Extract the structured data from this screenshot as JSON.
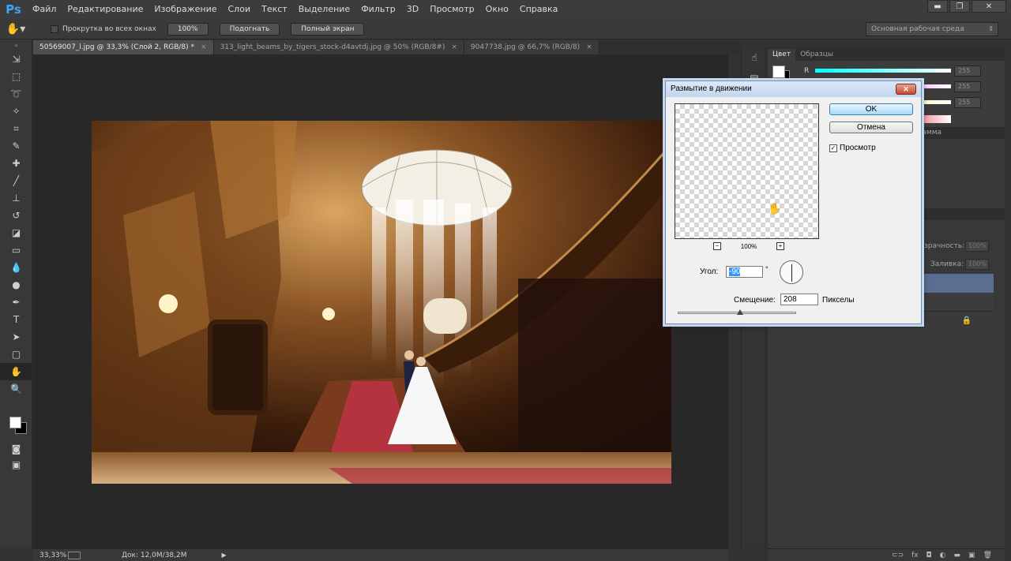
{
  "app": {
    "logo": "Ps"
  },
  "menu": [
    "Файл",
    "Редактирование",
    "Изображение",
    "Слои",
    "Текст",
    "Выделение",
    "Фильтр",
    "3D",
    "Просмотр",
    "Окно",
    "Справка"
  ],
  "window_controls": {
    "minimize": "▬",
    "restore": "❐",
    "close": "✕"
  },
  "options_bar": {
    "scroll_all_label": "Прокрутка во всех окнах",
    "zoom_100": "100%",
    "fit_label": "Подогнать",
    "fullscreen_label": "Полный экран",
    "workspace": "Основная рабочая среда"
  },
  "tabs": [
    {
      "label": "50569007_l.jpg @ 33,3% (Слой 2, RGB/8) *",
      "close": "×",
      "active": true
    },
    {
      "label": "313_light_beams_by_tigers_stock-d4avtdj.jpg @ 50% (RGB/8#)",
      "close": "×",
      "active": false
    },
    {
      "label": "9047738.jpg @ 66,7% (RGB/8)",
      "close": "×",
      "active": false
    }
  ],
  "status": {
    "zoom": "33,33%",
    "doc": "Док: 12,0M/38,2M"
  },
  "panels": {
    "color_tab": "Цвет",
    "swatches_tab": "Образцы",
    "channel_r": "R",
    "values": [
      "255",
      "255",
      "255"
    ],
    "adjust_label": "рамма",
    "opacity_label": "зрачность:",
    "opacity_value": "100%",
    "fill_label": "Заливка:",
    "fill_value": "100%"
  },
  "dialog": {
    "title": "Размытие в движении",
    "close": "✕",
    "ok": "OK",
    "cancel": "Отмена",
    "preview_label": "Просмотр",
    "preview_checked": true,
    "zoom_value": "100%",
    "angle_label": "Угол:",
    "angle_value": "-90",
    "deg_symbol": "°",
    "distance_label": "Смещение:",
    "distance_value": "208",
    "distance_unit": "Пикселы"
  },
  "colors": {
    "accent": "#3ea3f5",
    "selected_layer": "#5b6e91"
  }
}
